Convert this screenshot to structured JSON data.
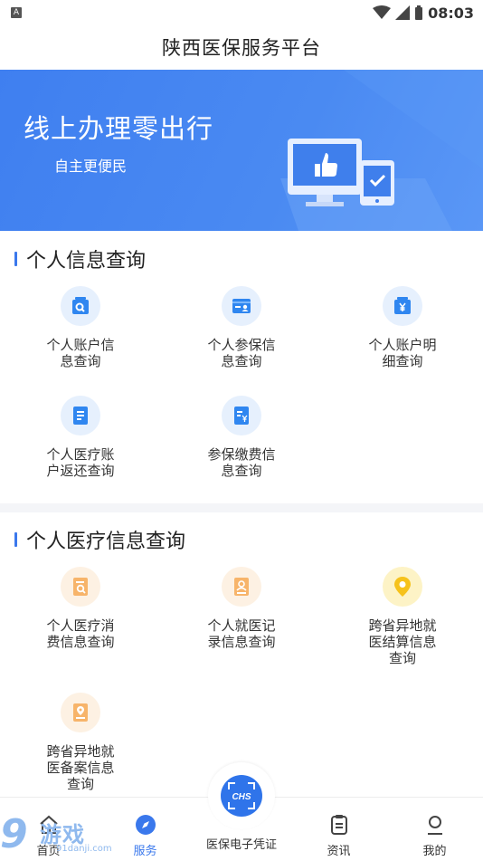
{
  "status_bar": {
    "sim_badge": "A",
    "time": "08:03"
  },
  "app_bar": {
    "title": "陕西医保服务平台"
  },
  "banner": {
    "title": "线上办理零出行",
    "subtitle": "自主更便民"
  },
  "sections": [
    {
      "title": "个人信息查询",
      "items": [
        {
          "label": "个人账户信息查询",
          "icon": "account-search-icon",
          "tone": "blue"
        },
        {
          "label": "个人参保信息查询",
          "icon": "insurance-card-icon",
          "tone": "blue"
        },
        {
          "label": "个人账户明细查询",
          "icon": "yuan-wallet-icon",
          "tone": "blue"
        },
        {
          "label": "个人医疗账户返还查询",
          "icon": "document-list-icon",
          "tone": "blue"
        },
        {
          "label": "参保缴费信息查询",
          "icon": "yuan-bill-icon",
          "tone": "blue"
        }
      ]
    },
    {
      "title": "个人医疗信息查询",
      "items": [
        {
          "label": "个人医疗消费信息查询",
          "icon": "medical-search-icon",
          "tone": "orange"
        },
        {
          "label": "个人就医记录信息查询",
          "icon": "medical-record-icon",
          "tone": "orange"
        },
        {
          "label": "跨省异地就医结算信息查询",
          "icon": "location-pin-icon",
          "tone": "yellow"
        },
        {
          "label": "跨省异地就医备案信息查询",
          "icon": "location-file-icon",
          "tone": "orange"
        }
      ]
    }
  ],
  "tab_bar": {
    "tabs": [
      {
        "label": "首页",
        "icon": "home-icon"
      },
      {
        "label": "服务",
        "icon": "compass-icon",
        "active": true
      },
      {
        "label": "医保电子凭证",
        "icon": "chs-scan-icon"
      },
      {
        "label": "资讯",
        "icon": "news-icon"
      },
      {
        "label": "我的",
        "icon": "user-icon"
      }
    ],
    "center_badge": "CHS"
  },
  "watermark": {
    "digit": "9",
    "text": "游戏",
    "url": "91danji.com"
  },
  "colors": {
    "primary": "#3a78ec",
    "banner": "#4a8af2",
    "orange_icon": "#f5a54a",
    "yellow_icon": "#f6c21b"
  }
}
